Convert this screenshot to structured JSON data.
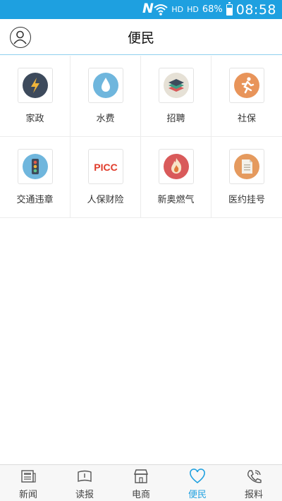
{
  "status_bar": {
    "carrier_icon": "N",
    "signal_icon": "wifi-icon",
    "hd1": "HD",
    "hd2": "HD",
    "battery_pct": "68%",
    "battery_level": 0.68,
    "time": "08:58"
  },
  "header": {
    "title": "便民",
    "user_icon": "user-icon"
  },
  "services": [
    {
      "label": "家政",
      "icon": "lightning-icon",
      "color": "#3d4a5c"
    },
    {
      "label": "水费",
      "icon": "water-drop-icon",
      "color": "#6fb6dd"
    },
    {
      "label": "招聘",
      "icon": "layers-icon",
      "color": "#e6e1d6"
    },
    {
      "label": "社保",
      "icon": "running-person-icon",
      "color": "#e8945a"
    },
    {
      "label": "交通违章",
      "icon": "traffic-light-icon",
      "color": "#6fb6dd"
    },
    {
      "label": "人保财险",
      "icon": "picc-logo",
      "color": "#e03b2a",
      "logo_text": "PICC"
    },
    {
      "label": "新奥燃气",
      "icon": "flame-icon",
      "color": "#d95a5a"
    },
    {
      "label": "医约挂号",
      "icon": "document-icon",
      "color": "#e59a5e"
    }
  ],
  "tabs": [
    {
      "label": "新闻",
      "icon": "news-icon",
      "active": false
    },
    {
      "label": "读报",
      "icon": "newspaper-icon",
      "active": false
    },
    {
      "label": "电商",
      "icon": "shop-icon",
      "active": false
    },
    {
      "label": "便民",
      "icon": "heart-icon",
      "active": true
    },
    {
      "label": "报料",
      "icon": "phone-icon",
      "active": false
    }
  ],
  "colors": {
    "accent": "#1ea0e0",
    "divider": "#ececec"
  }
}
